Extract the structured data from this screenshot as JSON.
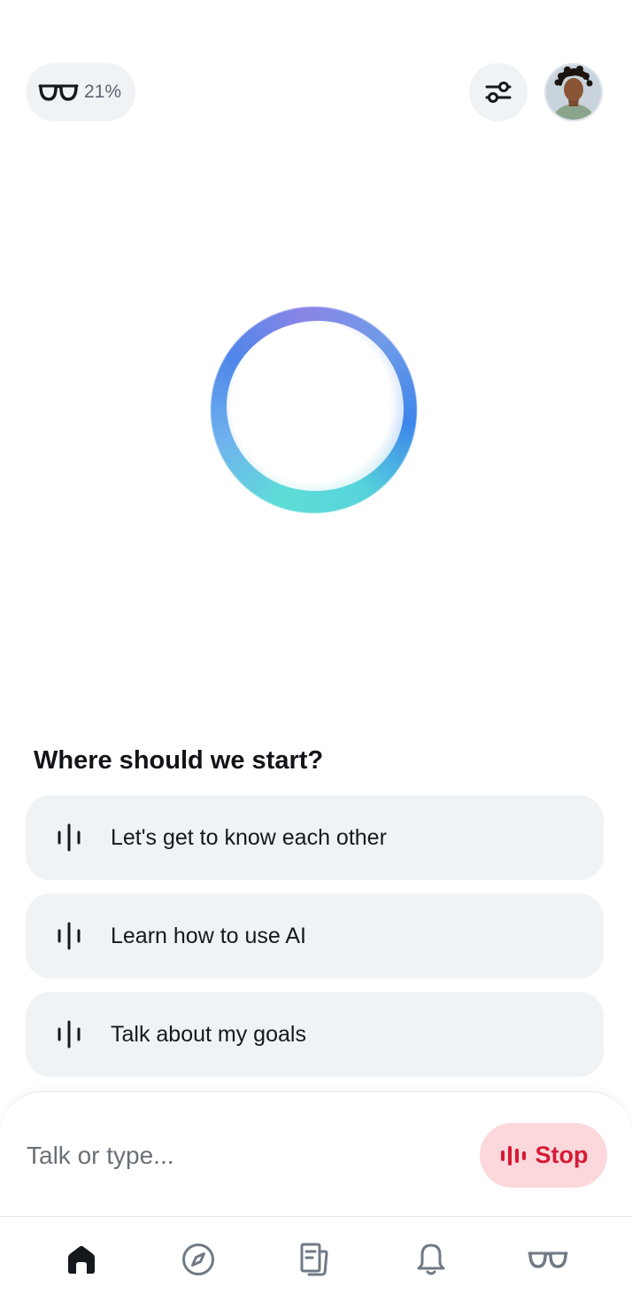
{
  "header": {
    "glasses_battery": "21%",
    "icons": {
      "glasses": "glasses-icon",
      "settings": "sliders-icon",
      "avatar": "user-avatar"
    }
  },
  "orb": {
    "state": "listening"
  },
  "suggestions": {
    "heading": "Where should we start?",
    "items": [
      {
        "label": "Let's get to know each other",
        "icon": "voice-wave-icon"
      },
      {
        "label": "Learn how to use AI",
        "icon": "voice-wave-icon"
      },
      {
        "label": "Talk about my goals",
        "icon": "voice-wave-icon"
      }
    ]
  },
  "composer": {
    "placeholder": "Talk or type...",
    "stop_label": "Stop"
  },
  "nav": {
    "items": [
      {
        "name": "home",
        "icon": "home-icon",
        "active": true
      },
      {
        "name": "explore",
        "icon": "compass-icon",
        "active": false
      },
      {
        "name": "feed",
        "icon": "document-icon",
        "active": false
      },
      {
        "name": "notifications",
        "icon": "bell-icon",
        "active": false
      },
      {
        "name": "glasses",
        "icon": "glasses-icon",
        "active": false
      }
    ]
  },
  "colors": {
    "pill_bg": "#f0f3f6",
    "stop_bg": "#fcd8dc",
    "stop_text": "#d61b36",
    "orb_teal": "#5eddd8",
    "orb_blue": "#4f86ea",
    "orb_violet": "#8b85e6"
  }
}
